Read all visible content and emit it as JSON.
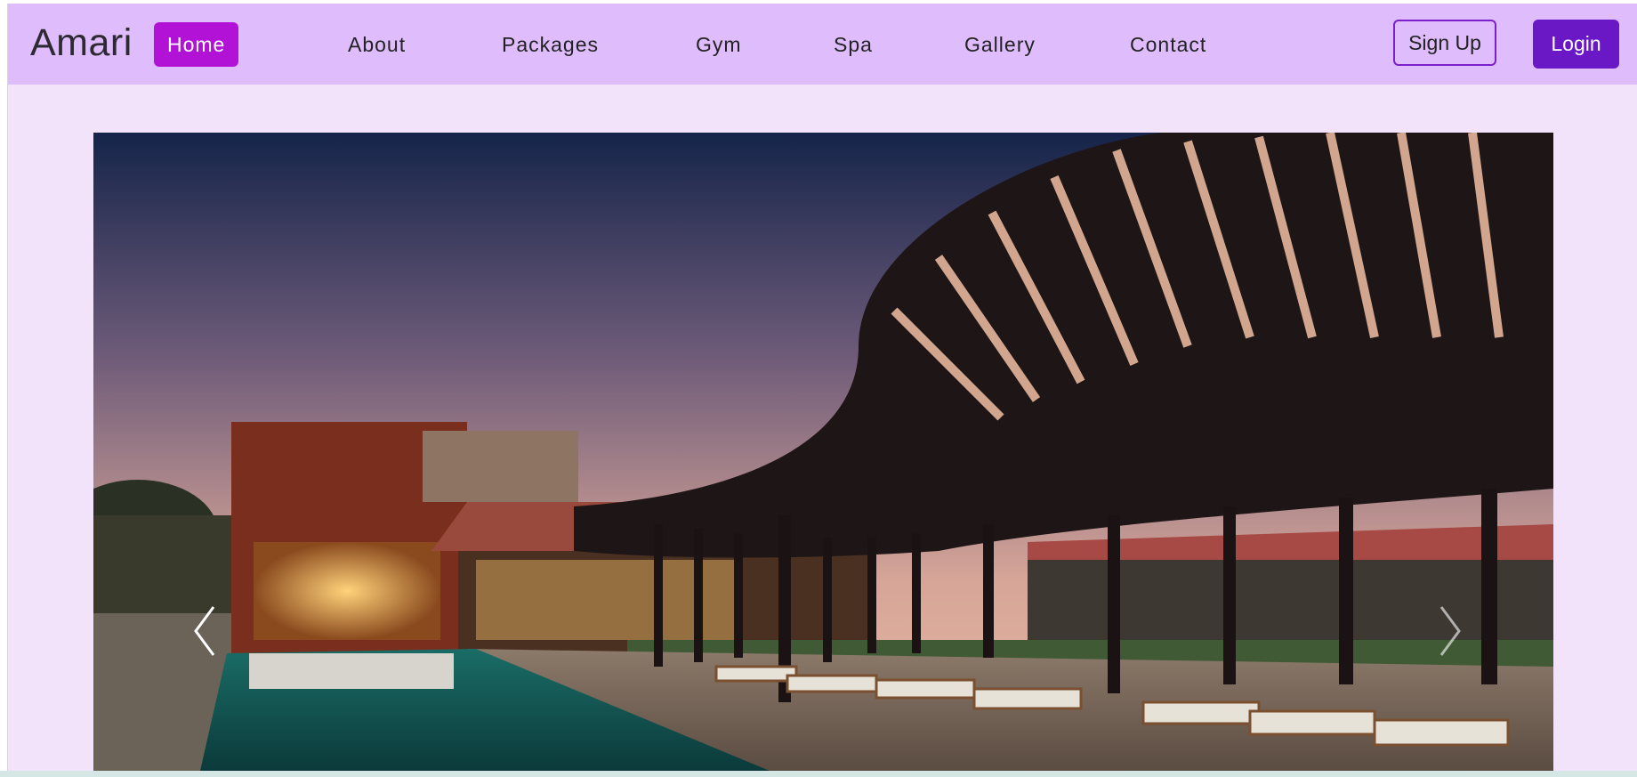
{
  "brand": {
    "name": "Amari"
  },
  "nav": {
    "items": [
      {
        "label": "Home",
        "active": true
      },
      {
        "label": "About",
        "active": false
      },
      {
        "label": "Packages",
        "active": false
      },
      {
        "label": "Gym",
        "active": false
      },
      {
        "label": "Spa",
        "active": false
      },
      {
        "label": "Gallery",
        "active": false
      },
      {
        "label": "Contact",
        "active": false
      }
    ]
  },
  "auth": {
    "signup_label": "Sign Up",
    "login_label": "Login"
  },
  "carousel": {
    "prev_icon": "chevron-left-icon",
    "next_icon": "chevron-right-icon",
    "slide_image": "resort-pool-pergola-dusk-photo"
  },
  "colors": {
    "navbar_bg": "#dfbcfc",
    "page_bg": "#f3e3fa",
    "active_nav": "#b112d6",
    "login_bg": "#6a18c6",
    "signup_border": "#7a1fc9"
  }
}
